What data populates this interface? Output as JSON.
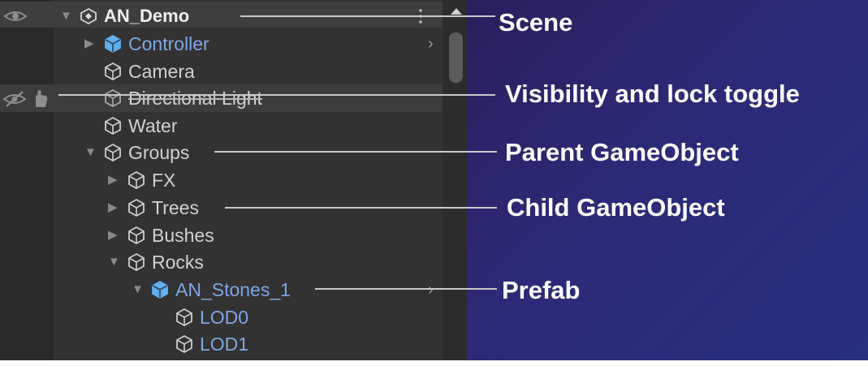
{
  "hierarchy": {
    "rows": [
      {
        "label": "AN_Demo",
        "icon": "unity-scene-icon",
        "fold": "expanded",
        "style": "scene"
      },
      {
        "label": "Controller",
        "icon": "prefab-cube-icon",
        "fold": "collapsed",
        "style": "prefab",
        "chevron": "›"
      },
      {
        "label": "Camera",
        "icon": "gameobject-cube-icon",
        "fold": "none",
        "style": "normal"
      },
      {
        "label": "Directional Light",
        "icon": "gameobject-cube-icon",
        "fold": "none",
        "style": "hidden"
      },
      {
        "label": "Water",
        "icon": "gameobject-cube-icon",
        "fold": "none",
        "style": "normal"
      },
      {
        "label": "Groups",
        "icon": "gameobject-cube-icon",
        "fold": "expanded",
        "style": "normal"
      },
      {
        "label": "FX",
        "icon": "gameobject-cube-icon",
        "fold": "collapsed",
        "style": "normal"
      },
      {
        "label": "Trees",
        "icon": "gameobject-cube-icon",
        "fold": "collapsed",
        "style": "normal"
      },
      {
        "label": "Bushes",
        "icon": "gameobject-cube-icon",
        "fold": "collapsed",
        "style": "normal"
      },
      {
        "label": "Rocks",
        "icon": "gameobject-cube-icon",
        "fold": "expanded",
        "style": "normal"
      },
      {
        "label": "AN_Stones_1",
        "icon": "prefab-cube-icon",
        "fold": "expanded",
        "style": "prefab",
        "chevron": "›"
      },
      {
        "label": "LOD0",
        "icon": "gameobject-cube-icon",
        "fold": "none",
        "style": "prefab-child"
      },
      {
        "label": "LOD1",
        "icon": "gameobject-cube-icon",
        "fold": "none",
        "style": "prefab-child"
      }
    ],
    "scene_menu_icon": "kebab-menu-icon",
    "visibility_icon": "eye-icon",
    "hidden_icon": "eye-crossed-icon",
    "lock_icon": "hand-pick-icon"
  },
  "annotations": {
    "scene": "Scene",
    "visibility": "Visibility and lock toggle",
    "parent": "Parent GameObject",
    "child": "Child GameObject",
    "prefab": "Prefab"
  },
  "colors": {
    "panel": "#323232",
    "prefab_text": "#7fa6e4",
    "prefab_icon": "#5fb0ec",
    "text": "#d2d2d2",
    "callout_text": "#ffffff",
    "callout_bg_start": "#2a1e5c",
    "callout_bg_end": "#262f80"
  }
}
